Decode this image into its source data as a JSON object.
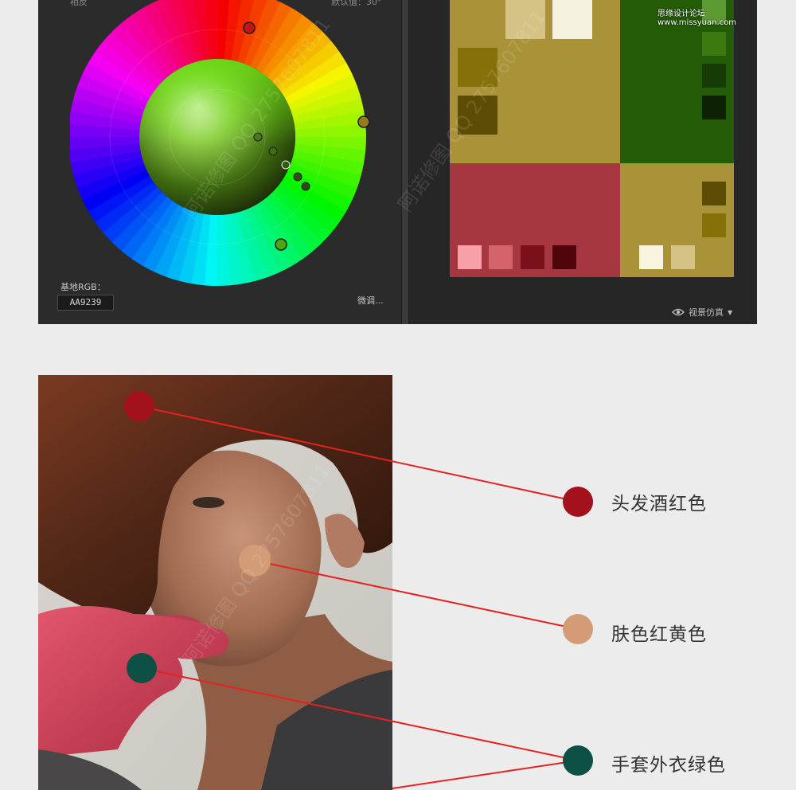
{
  "colors": {
    "olive": "#aa9239",
    "green": "#235b07",
    "red": "#a6363f",
    "hair_red": "#a3111c",
    "skin": "#d39b76",
    "glove_green": "#0e5144",
    "line_red": "#e52222"
  },
  "wheel_panel": {
    "hue_label": "相反",
    "default_label": "默认值：30°",
    "base_rgb_label": "基地RGB：",
    "base_rgb_value": "AA9239",
    "fine_tune": "微调..."
  },
  "swatch_panel": {
    "view_sim": "视景仿真",
    "icons": [
      "eye-icon",
      "caret-down-icon"
    ]
  },
  "brand": "思缘设计论坛 www.missyuan.com",
  "callouts": [
    {
      "label": "头发酒红色",
      "color": "#a3111c"
    },
    {
      "label": "肤色红黄色",
      "color": "#d39b76"
    },
    {
      "label": "手套外衣绿色",
      "color": "#0e5144"
    }
  ],
  "watermark": "阿诺修图 QQ 2757607811"
}
